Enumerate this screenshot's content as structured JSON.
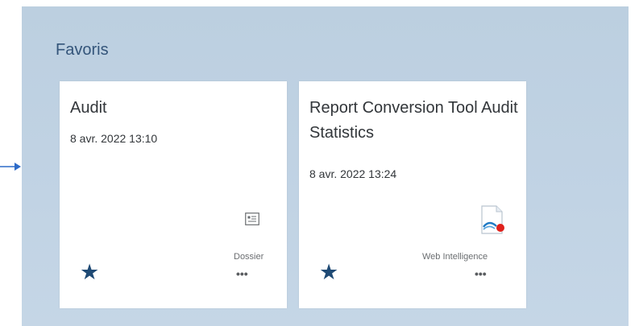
{
  "favorites": {
    "title": "Favoris",
    "tiles": [
      {
        "title": "Audit",
        "date": "8 avr. 2022 13:10",
        "type_label": "Dossier",
        "type_icon": "folder-card-icon",
        "favorite": true,
        "more_label": "•••"
      },
      {
        "title": "Report Conversion Tool Audit Statistics",
        "date": "8 avr. 2022 13:24",
        "type_label": "Web Intelligence",
        "type_icon": "web-intelligence-document-icon",
        "favorite": true,
        "more_label": "•••"
      }
    ]
  },
  "colors": {
    "panel": "#bed1e2",
    "title": "#34557a",
    "star": "#1f4a75",
    "arrow": "#2e6bc8",
    "webi_red": "#e0211c",
    "webi_blue": "#1f7ac4"
  }
}
